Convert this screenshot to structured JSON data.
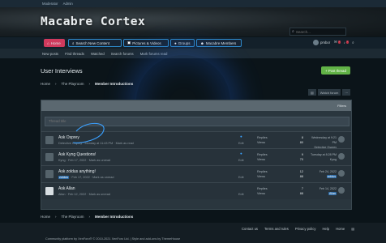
{
  "topbar": {
    "moderator": "Moderator",
    "admin": "Admin"
  },
  "header": {
    "site_title": "Macabre Cortex",
    "search_placeholder": "Search..."
  },
  "nav": {
    "home": "Home",
    "new_content": "Search New Content",
    "pictures": "Pictures & Videos",
    "groups": "Groups",
    "members": "Macabre Members",
    "username": "pmbor"
  },
  "subnav": [
    "New posts",
    "Find threads",
    "Watched",
    "Search forums",
    "Mark forums read"
  ],
  "page": {
    "title": "User Interviews",
    "post_thread": "+ Post thread",
    "breadcrumb": [
      "Home",
      "The Playroom",
      "Member Introductions"
    ],
    "watch_label": "Watch forum",
    "filters": "Filters",
    "quick_thread_placeholder": "Thread title"
  },
  "threads": [
    {
      "title": "Ask Osprey",
      "starter": "Detective Osprey",
      "date": "Monday at 11:43 PM",
      "extra": "Mark as read",
      "replies": "8",
      "views": "80",
      "last_date": "Wednesday at 9:21 PM",
      "last_user": "Detective Osprey"
    },
    {
      "title": "Ask Kyng Questions!",
      "starter": "Kyng",
      "date": "Feb 17, 2022",
      "extra": "Mark as unread",
      "replies": "9",
      "views": "70",
      "last_date": "Tuesday at 8:28 PM",
      "last_user": "Kyng"
    },
    {
      "title": "Ask zoldus anything!",
      "starter": "zoldus",
      "date": "Feb 17, 2022",
      "extra": "Mark as unread",
      "replies": "12",
      "views": "88",
      "last_date": "Feb 24, 2022",
      "last_user": "zoldus"
    },
    {
      "title": "Ask Allan",
      "starter": "Allan",
      "date": "Feb 12, 2022",
      "extra": "Mark as unread",
      "replies": "7",
      "views": "88",
      "last_date": "Feb 14, 2022",
      "last_user": "Allan"
    }
  ],
  "labels": {
    "replies": "Replies",
    "views": "Views",
    "edit": "Edit"
  },
  "footer": {
    "links": [
      "Contact us",
      "Terms and rules",
      "Privacy policy",
      "Help",
      "Home"
    ],
    "credit": "Community platform by XenForo® © 2010-2021 XenForo Ltd. | Style and add-ons by ThemeHouse"
  }
}
